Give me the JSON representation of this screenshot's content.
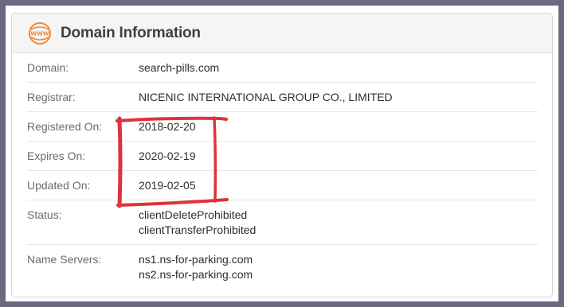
{
  "header": {
    "title": "Domain Information",
    "icon": "www-globe-icon",
    "icon_text": "WWW",
    "icon_color": "#f0883e"
  },
  "rows": [
    {
      "label": "Domain:",
      "values": [
        "search-pills.com"
      ]
    },
    {
      "label": "Registrar:",
      "values": [
        "NICENIC INTERNATIONAL GROUP CO., LIMITED"
      ]
    },
    {
      "label": "Registered On:",
      "values": [
        "2018-02-20"
      ]
    },
    {
      "label": "Expires On:",
      "values": [
        "2020-02-19"
      ]
    },
    {
      "label": "Updated On:",
      "values": [
        "2019-02-05"
      ]
    },
    {
      "label": "Status:",
      "values": [
        "clientDeleteProhibited",
        "clientTransferProhibited"
      ]
    },
    {
      "label": "Name Servers:",
      "values": [
        "ns1.ns-for-parking.com",
        "ns2.ns-for-parking.com"
      ]
    }
  ],
  "annotation": {
    "type": "hand-drawn-box",
    "color": "#e0323a"
  }
}
